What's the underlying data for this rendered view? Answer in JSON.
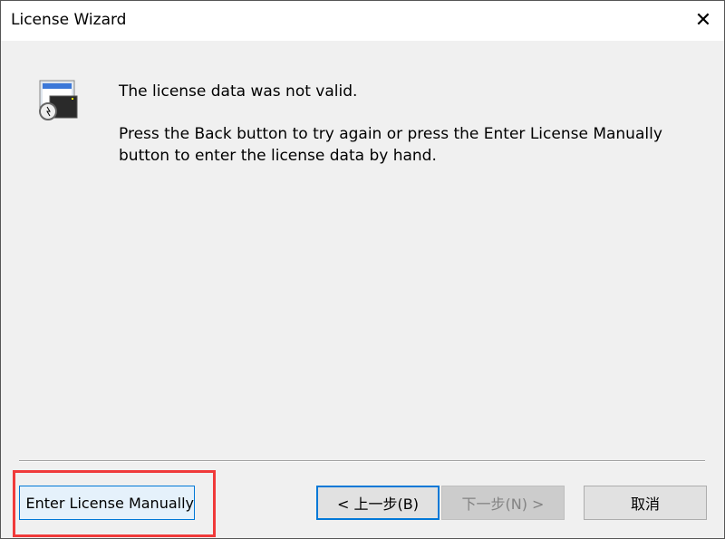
{
  "window": {
    "title": "License Wizard",
    "close_label": "✕"
  },
  "message": {
    "line1": "The license data was not valid.",
    "line2": "Press the Back button to try again or press the Enter License Manually",
    "line3": "button to enter the license data by hand."
  },
  "buttons": {
    "enter_manually": "Enter License Manually",
    "back": "< 上一步(B)",
    "next": "下一步(N) >",
    "cancel": "取消"
  }
}
